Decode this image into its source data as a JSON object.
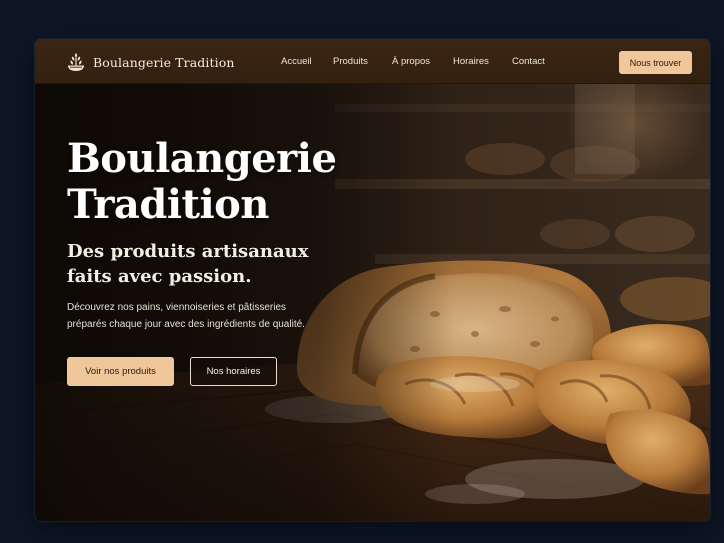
{
  "brand": {
    "name": "Boulangerie Tradition",
    "logo_icon": "wheat-icon"
  },
  "nav": {
    "links": [
      {
        "label": "Accueil"
      },
      {
        "label": "Produits"
      },
      {
        "label": "À propos"
      },
      {
        "label": "Horaires"
      },
      {
        "label": "Contact"
      }
    ],
    "cta_label": "Nous trouver"
  },
  "hero": {
    "title_line1": "Boulangerie",
    "title_line2": "Tradition",
    "subtitle_line1": "Des produits artisanaux",
    "subtitle_line2": "faits avec passion.",
    "description_line1": "Découvrez nos pains, viennoiseries et pâtisseries",
    "description_line2": "préparés chaque jour avec des ingrédients de qualité.",
    "primary_button": "Voir nos produits",
    "secondary_button": "Nos horaires",
    "image": "bread-loaves-on-wooden-table"
  },
  "colors": {
    "page_background": "#0e1626",
    "navbar": "#3b2515",
    "accent": "#f0c79a",
    "text_light": "#f6eee2"
  }
}
